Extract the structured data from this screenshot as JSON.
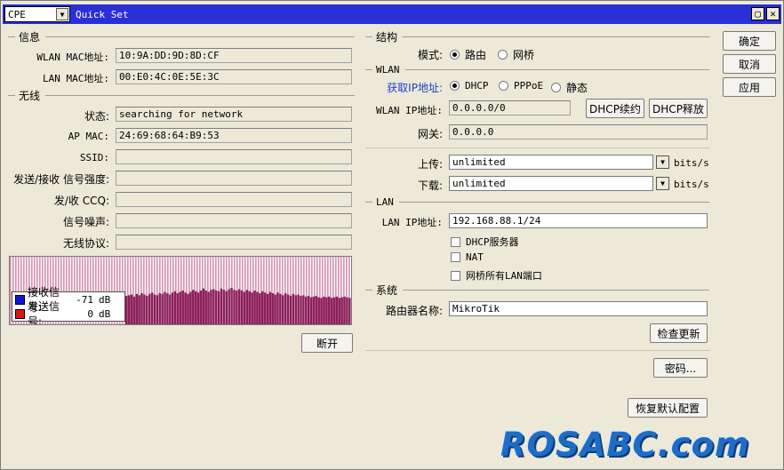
{
  "titlebar": {
    "mode_value": "CPE",
    "title": "Quick Set"
  },
  "actions": {
    "ok": "确定",
    "cancel": "取消",
    "apply": "应用"
  },
  "info": {
    "section": "信息",
    "wlan_mac_label": "WLAN MAC地址:",
    "wlan_mac": "10:9A:DD:9D:8D:CF",
    "lan_mac_label": "LAN MAC地址:",
    "lan_mac": "00:E0:4C:0E:5E:3C"
  },
  "wireless": {
    "section": "无线",
    "status_label": "状态:",
    "status": "searching for network",
    "ap_mac_label": "AP MAC:",
    "ap_mac": "24:69:68:64:B9:53",
    "ssid_label": "SSID:",
    "ssid": "",
    "signal_label": "发送/接收 信号强度:",
    "signal": "",
    "ccq_label": "发/收 CCQ:",
    "ccq": "",
    "noise_label": "信号噪声:",
    "noise": "",
    "protocol_label": "无线协议:",
    "protocol": "",
    "disconnect": "断开"
  },
  "graph": {
    "rx_label": "接收信号:",
    "rx_value": "-71",
    "rx_unit": "dB",
    "tx_label": "发送信号:",
    "tx_value": "0",
    "tx_unit": "dB",
    "colors": {
      "rx": "#1515d8",
      "tx": "#e01515",
      "bars": "#8b1f5a",
      "top": "#b23a6a"
    },
    "rx_levels": [
      0.42,
      0.43,
      0.44,
      0.41,
      0.45,
      0.43,
      0.46,
      0.44,
      0.42,
      0.45,
      0.47,
      0.44,
      0.43,
      0.46,
      0.45,
      0.48,
      0.46,
      0.44,
      0.47,
      0.49,
      0.46,
      0.48,
      0.5,
      0.47,
      0.45,
      0.48,
      0.51,
      0.49,
      0.47,
      0.5,
      0.53,
      0.5,
      0.48,
      0.51,
      0.52,
      0.5,
      0.49,
      0.53,
      0.51,
      0.49,
      0.52,
      0.54,
      0.51,
      0.5,
      0.52,
      0.5,
      0.48,
      0.51,
      0.49,
      0.47,
      0.5,
      0.48,
      0.46,
      0.49,
      0.47,
      0.45,
      0.48,
      0.46,
      0.44,
      0.47,
      0.45,
      0.43,
      0.46,
      0.44,
      0.42,
      0.45,
      0.43,
      0.44,
      0.42,
      0.43,
      0.41,
      0.42,
      0.4,
      0.41,
      0.42,
      0.4,
      0.39,
      0.41,
      0.4,
      0.41,
      0.39,
      0.4,
      0.41,
      0.39,
      0.4,
      0.41,
      0.4,
      0.39
    ]
  },
  "structure": {
    "section": "结构",
    "mode_label": "模式:",
    "router": "路由",
    "bridge": "网桥"
  },
  "wlan": {
    "section": "WLAN",
    "get_ip_label": "获取IP地址:",
    "dhcp": "DHCP",
    "pppoe": "PPPoE",
    "static": "静态",
    "ip_label": "WLAN IP地址:",
    "ip": "0.0.0.0/0",
    "renew": "DHCP续约",
    "release": "DHCP释放",
    "gateway_label": "网关:",
    "gateway": "0.0.0.0",
    "upload_label": "上传:",
    "upload": "unlimited",
    "download_label": "下载:",
    "download": "unlimited",
    "unit": "bits/s"
  },
  "lan": {
    "section": "LAN",
    "ip_label": "LAN IP地址:",
    "ip": "192.168.88.1/24",
    "dhcp_server": "DHCP服务器",
    "nat": "NAT",
    "bridge_all": "网桥所有LAN端口"
  },
  "system": {
    "section": "系统",
    "router_name_label": "路由器名称:",
    "router_name": "MikroTik",
    "check_updates": "检查更新",
    "password": "密码...",
    "reset": "恢复默认配置"
  },
  "watermark": "ROSABC.com"
}
